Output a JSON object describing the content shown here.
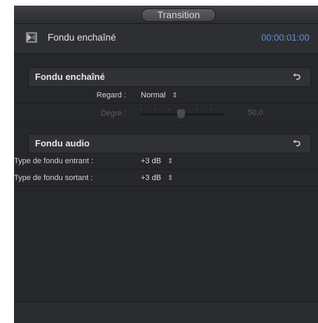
{
  "titlebar": {
    "tab_label": "Transition"
  },
  "header": {
    "title": "Fondu enchaîné",
    "timecode": "00:00:01:00"
  },
  "section_video": {
    "title": "Fondu enchaîné",
    "regard": {
      "label": "Regard :",
      "value": "Normal"
    },
    "degre": {
      "label": "Degré :",
      "value": "50,0"
    }
  },
  "section_audio": {
    "title": "Fondu audio",
    "fade_in": {
      "label": "Type de fondu entrant :",
      "value": "+3 dB"
    },
    "fade_out": {
      "label": "Type de fondu sortant :",
      "value": "+3 dB"
    }
  },
  "icons": {
    "header_icon": "film-icon",
    "reset": "reset-arrow-icon",
    "popup": "up-down-arrows-icon"
  },
  "colors": {
    "panel_bg": "#26272a",
    "timecode": "#5f8fd9",
    "section_bg": "#313236",
    "disabled_text": "#5d5e62"
  }
}
